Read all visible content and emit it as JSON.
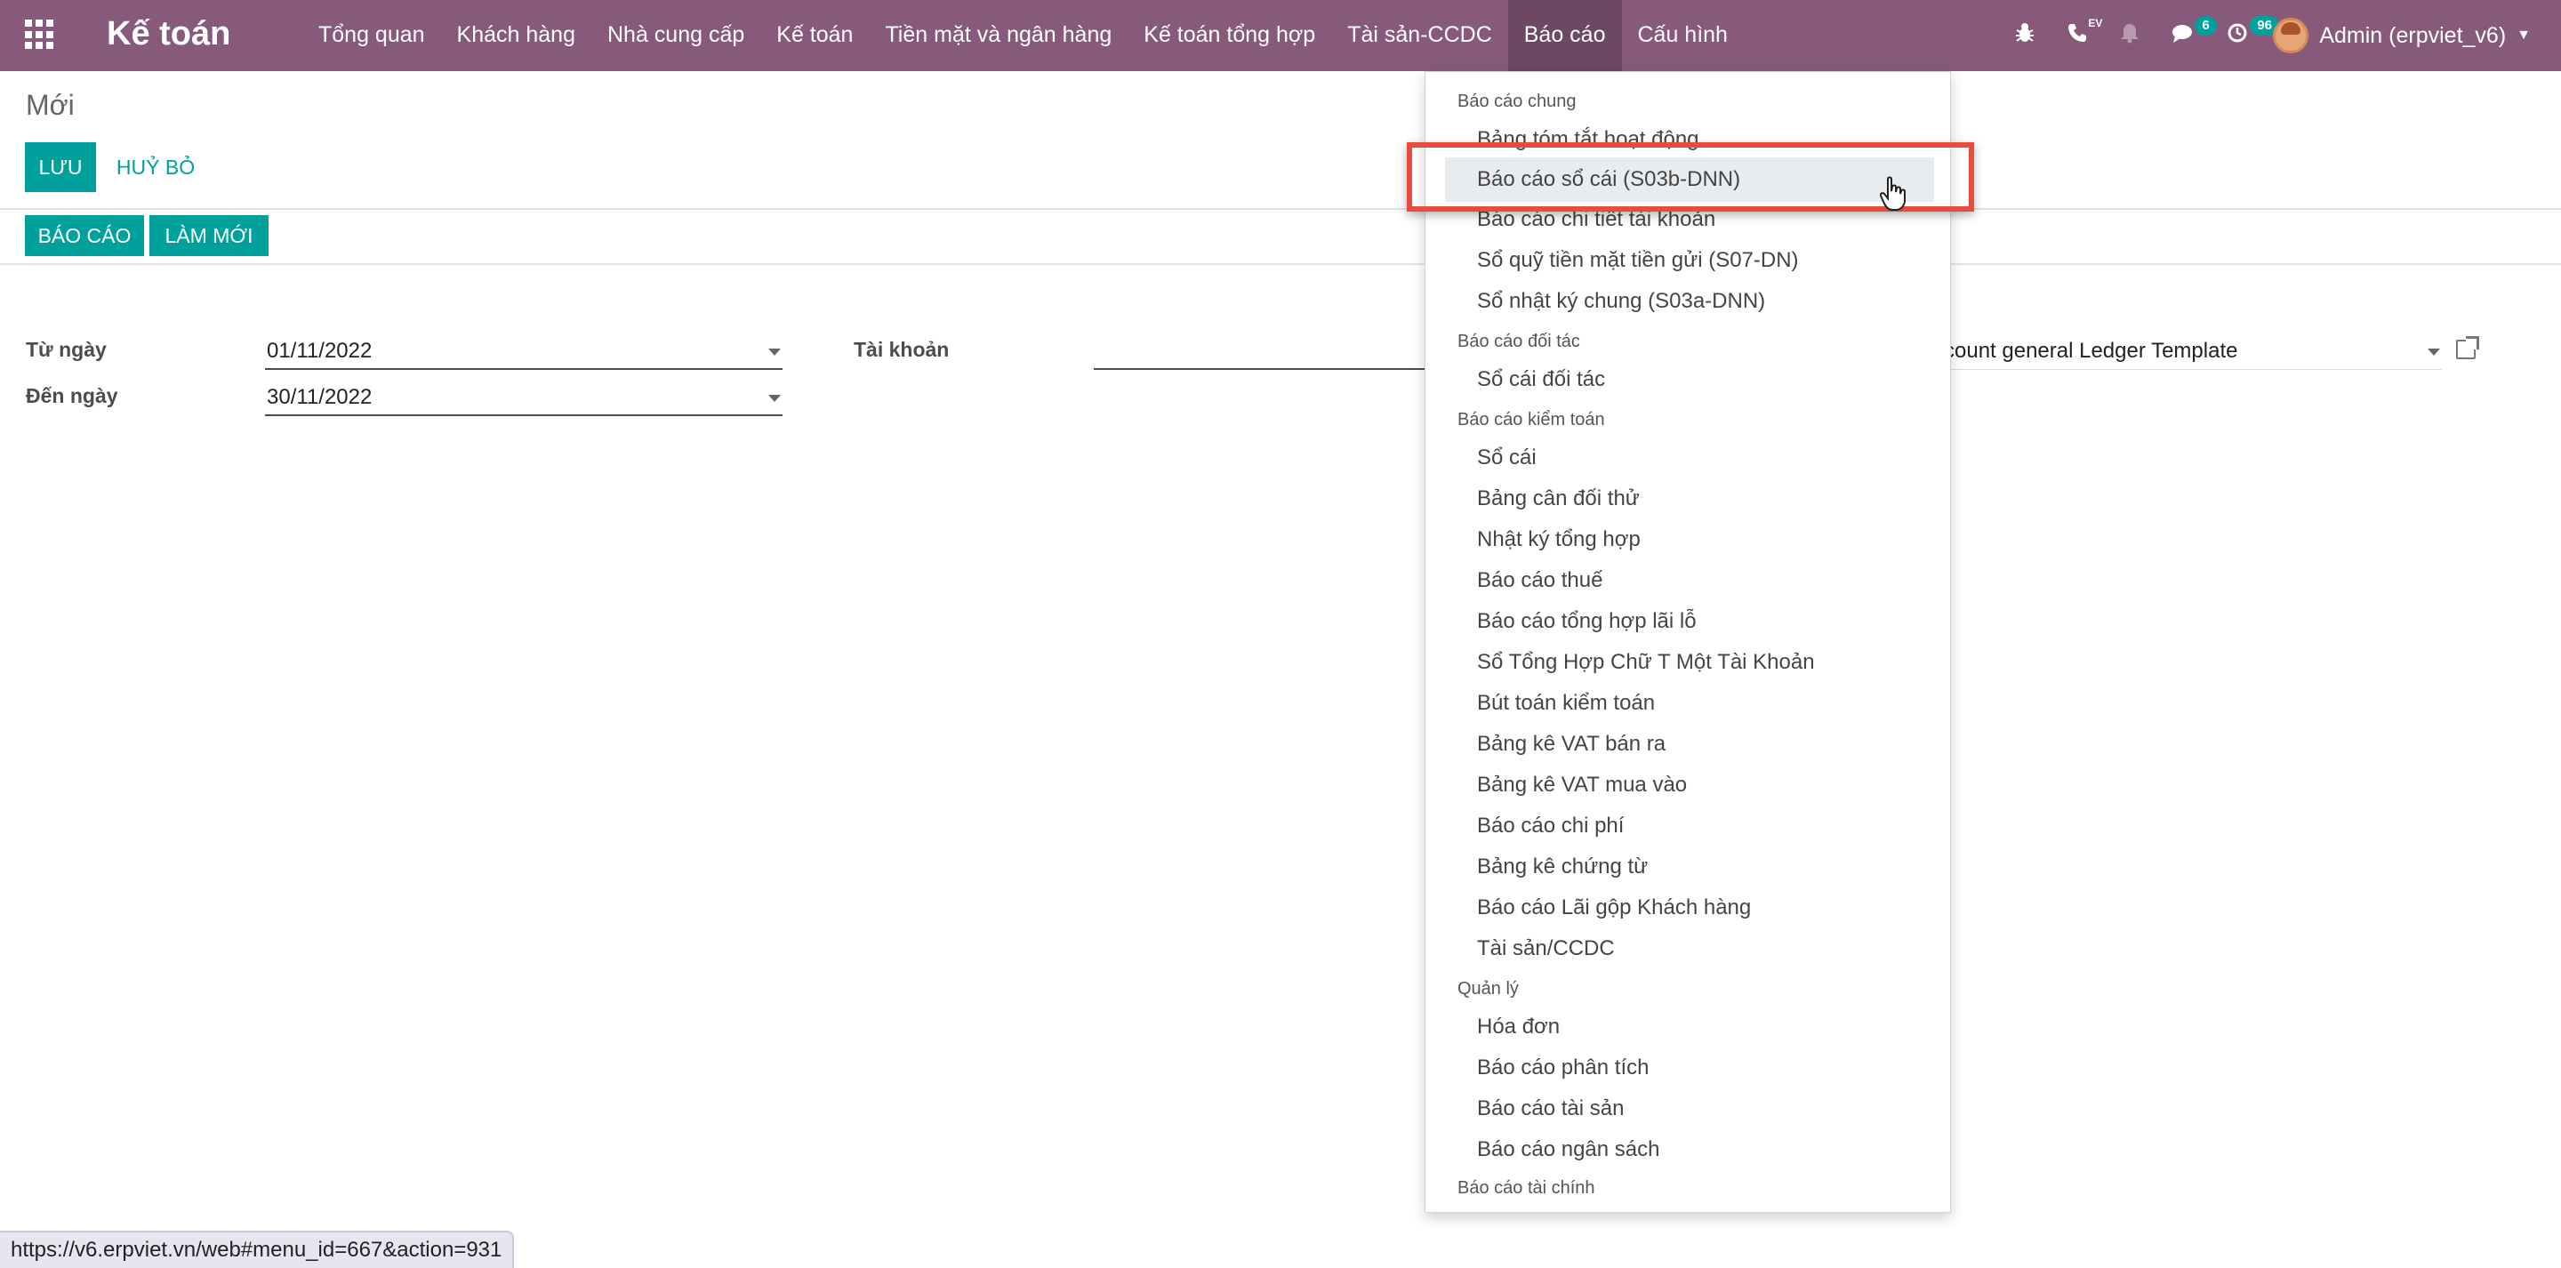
{
  "navbar": {
    "apps_icon": "grid-icon",
    "brand": "Kế toán",
    "menu": [
      "Tổng quan",
      "Khách hàng",
      "Nhà cung cấp",
      "Kế toán",
      "Tiền mặt và ngân hàng",
      "Kế toán tổng hợp",
      "Tài sản-CCDC",
      "Báo cáo",
      "Cấu hình"
    ],
    "active_menu": "Báo cáo",
    "systray": {
      "bug_icon": "bug-icon",
      "phone_icon": "phone-icon",
      "phone_sup": "EV",
      "bell_icon": "bell-icon",
      "messages_icon": "chat-icon",
      "messages_count": "6",
      "activity_icon": "clock-icon",
      "activity_count": "96"
    },
    "user": "Admin (erpviet_v6)"
  },
  "control_panel": {
    "breadcrumb": "Mới",
    "save_label": "LƯU",
    "discard_label": "HUỶ BỎ",
    "report_label": "BÁO CÁO",
    "refresh_label": "LÀM MỚI"
  },
  "form": {
    "from_date_label": "Từ ngày",
    "from_date_value": "01/11/2022",
    "to_date_label": "Đến ngày",
    "to_date_value": "30/11/2022",
    "account_label": "Tài khoản",
    "template_value": "count general Ledger Template"
  },
  "dropdown": {
    "groups": [
      {
        "header": "Báo cáo chung",
        "items": [
          "Bảng tóm tắt hoạt động",
          "Báo cáo sổ cái (S03b-DNN)",
          "Báo cáo chi tiết tài khoản",
          "Sổ quỹ tiền mặt tiền gửi (S07-DN)",
          "Sổ nhật ký chung (S03a-DNN)"
        ]
      },
      {
        "header": "Báo cáo đối tác",
        "items": [
          "Sổ cái đối tác"
        ]
      },
      {
        "header": "Báo cáo kiểm toán",
        "items": [
          "Sổ cái",
          "Bảng cân đối thử",
          "Nhật ký tổng hợp",
          "Báo cáo thuế",
          "Báo cáo tổng hợp lãi lỗ",
          "Sổ Tổng Hợp Chữ T Một Tài Khoản",
          "Bút toán kiểm toán",
          "Bảng kê VAT bán ra",
          "Bảng kê VAT mua vào",
          "Báo cáo chi phí",
          "Bảng kê chứng từ",
          "Báo cáo Lãi gộp Khách hàng",
          "Tài sản/CCDC"
        ]
      },
      {
        "header": "Quản lý",
        "items": [
          "Hóa đơn",
          "Báo cáo phân tích",
          "Báo cáo tài sản",
          "Báo cáo ngân sách"
        ]
      },
      {
        "header": "Báo cáo tài chính",
        "items": []
      }
    ],
    "highlighted": "Báo cáo sổ cái (S03b-DNN)"
  },
  "status_url": "https://v6.erpviet.vn/web#menu_id=667&action=931",
  "colors": {
    "navbar": "#875a7b",
    "primary": "#00a09d",
    "highlight_border": "#e74c3c"
  }
}
